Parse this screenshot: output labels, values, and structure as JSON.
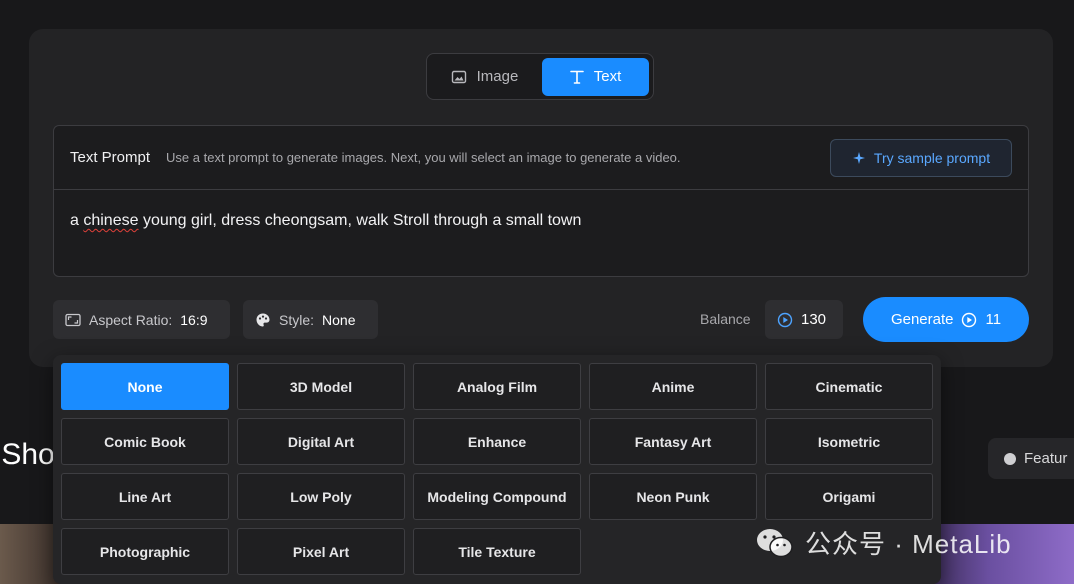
{
  "mode_toggle": {
    "tabs": [
      {
        "label": "Image",
        "icon": "image-icon",
        "active": false
      },
      {
        "label": "Text",
        "icon": "text-icon",
        "active": true
      }
    ]
  },
  "prompt": {
    "title": "Text Prompt",
    "hint": "Use a text prompt to generate images. Next, you will select an image to generate a video.",
    "sample_button": "Try sample prompt",
    "value_prefix": "a ",
    "value_misspelled": "chinese",
    "value_suffix": " young girl, dress cheongsam, walk Stroll through a small town"
  },
  "controls": {
    "aspect_label": "Aspect Ratio:",
    "aspect_value": "16:9",
    "style_label": "Style:",
    "style_value": "None",
    "balance_label": "Balance",
    "balance_value": "130",
    "generate_label": "Generate",
    "generate_cost": "11"
  },
  "style_options": [
    {
      "label": "None",
      "active": true
    },
    {
      "label": "3D Model"
    },
    {
      "label": "Analog Film"
    },
    {
      "label": "Anime"
    },
    {
      "label": "Cinematic"
    },
    {
      "label": "Comic Book"
    },
    {
      "label": "Digital Art"
    },
    {
      "label": "Enhance"
    },
    {
      "label": "Fantasy Art"
    },
    {
      "label": "Isometric"
    },
    {
      "label": "Line Art"
    },
    {
      "label": "Low Poly"
    },
    {
      "label": "Modeling Compound"
    },
    {
      "label": "Neon Punk"
    },
    {
      "label": "Origami"
    },
    {
      "label": "Photographic"
    },
    {
      "label": "Pixel Art"
    },
    {
      "label": "Tile Texture"
    }
  ],
  "background": {
    "heading_fragment": "v Sho",
    "feature_button": "Featur"
  },
  "watermark": "公众号 · MetaLib",
  "colors": {
    "accent": "#1a8cff",
    "card": "#232325",
    "page": "#18181a"
  }
}
